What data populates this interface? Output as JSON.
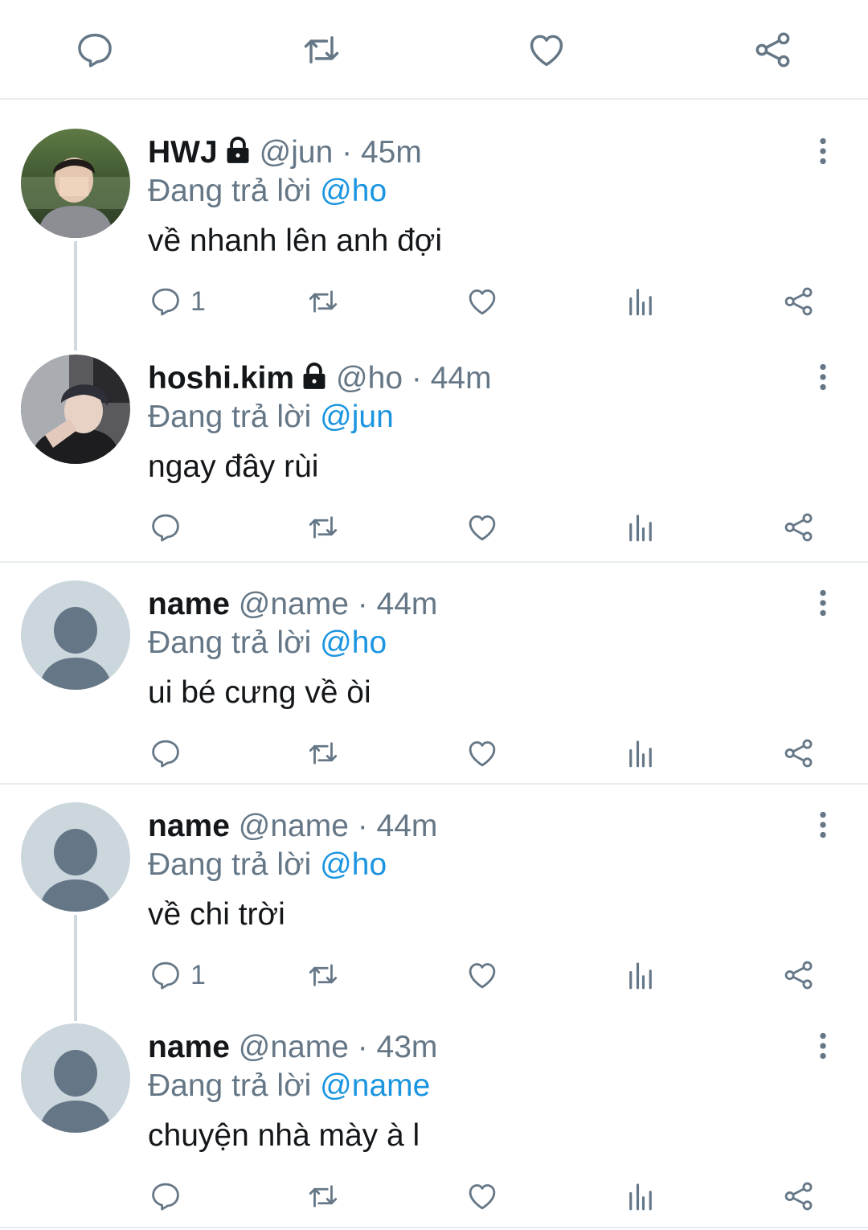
{
  "colors": {
    "text": "#14171a",
    "muted": "#657786",
    "mention": "#1b95e0",
    "icon": "#657786",
    "divider": "#e6ecf0"
  },
  "top_actions": [
    {
      "icon": "reply-icon"
    },
    {
      "icon": "retweet-icon"
    },
    {
      "icon": "like-icon"
    },
    {
      "icon": "share-icon"
    }
  ],
  "tweets": [
    {
      "display_name": "HWJ",
      "locked": true,
      "handle": "@jun",
      "time": "· 45m",
      "reply_prefix": "Đang trả lời",
      "reply_to": "@ho",
      "text": "về nhanh lên anh đợi",
      "reply_count": "1",
      "avatar": "photo-avatar"
    },
    {
      "display_name": "hoshi.kim",
      "locked": true,
      "handle": "@ho",
      "time": "· 44m",
      "reply_prefix": "Đang trả lời",
      "reply_to": "@jun",
      "text": "ngay đây rùi",
      "reply_count": "",
      "avatar": "photo-avatar"
    },
    {
      "display_name": "name",
      "locked": false,
      "handle": "@name",
      "time": "· 44m",
      "reply_prefix": "Đang trả lời",
      "reply_to": "@ho",
      "text": "ui bé cưng về òi",
      "reply_count": "",
      "avatar": "default-avatar"
    },
    {
      "display_name": "name",
      "locked": false,
      "handle": "@name",
      "time": "· 44m",
      "reply_prefix": "Đang trả lời",
      "reply_to": "@ho",
      "text": "về chi trời",
      "reply_count": "1",
      "avatar": "default-avatar"
    },
    {
      "display_name": "name",
      "locked": false,
      "handle": "@name",
      "time": "· 43m",
      "reply_prefix": "Đang trả lời",
      "reply_to": "@name",
      "text": "chuyện nhà mày à l",
      "reply_count": "",
      "avatar": "default-avatar"
    }
  ]
}
